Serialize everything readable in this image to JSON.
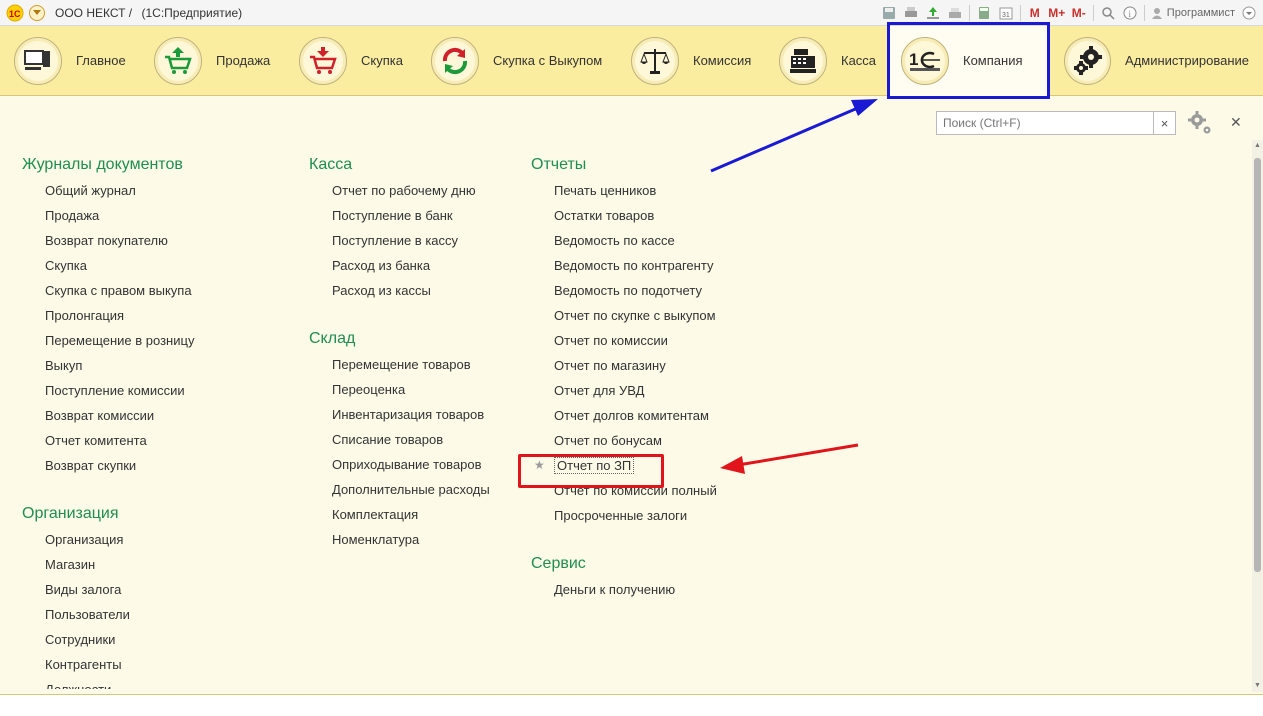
{
  "window": {
    "title_company": "ООО НЕКСТ /",
    "title_app": "(1С:Предприятие)",
    "user": "Программист",
    "mem_labels": [
      "M",
      "M+",
      "M-"
    ]
  },
  "sections": [
    {
      "label": "Главное",
      "icon": "computer-icon"
    },
    {
      "label": "Продажа",
      "icon": "cart-up-icon"
    },
    {
      "label": "Скупка",
      "icon": "cart-down-icon"
    },
    {
      "label": "Скупка с Выкупом",
      "icon": "cycle-icon"
    },
    {
      "label": "Комиссия",
      "icon": "scales-icon"
    },
    {
      "label": "Касса",
      "icon": "cash-register-icon"
    },
    {
      "label": "Компания",
      "icon": "company-logo-icon"
    },
    {
      "label": "Администрирование",
      "icon": "gears-icon"
    }
  ],
  "search": {
    "placeholder": "Поиск (Ctrl+F)"
  },
  "groups": {
    "journals": {
      "title": "Журналы документов",
      "items": [
        "Общий журнал",
        "Продажа",
        "Возврат покупателю",
        "Скупка",
        "Скупка с правом выкупа",
        "Пролонгация",
        "Перемещение в розницу",
        "Выкуп",
        "Поступление комиссии",
        "Возврат комиссии",
        "Отчет комитента",
        "Возврат скупки"
      ]
    },
    "organization": {
      "title": "Организация",
      "items": [
        "Организация",
        "Магазин",
        "Виды залога",
        "Пользователи",
        "Сотрудники",
        "Контрагенты",
        "Должности"
      ]
    },
    "cash": {
      "title": "Касса",
      "items": [
        "Отчет по рабочему дню",
        "Поступление в банк",
        "Поступление в кассу",
        "Расход из банка",
        "Расход из кассы"
      ]
    },
    "warehouse": {
      "title": "Склад",
      "items": [
        "Перемещение товаров",
        "Переоценка",
        "Инвентаризация товаров",
        "Списание товаров",
        "Оприходывание товаров",
        "Дополнительные расходы",
        "Комплектация",
        "Номенклатура"
      ]
    },
    "reports": {
      "title": "Отчеты",
      "items": [
        "Печать ценников",
        "Остатки товаров",
        "Ведомость по кассе",
        "Ведомость по контрагенту",
        "Ведомость по подотчету",
        "Отчет по скупке с выкупом",
        "Отчет по комиссии",
        "Отчет по магазину",
        "Отчет для УВД",
        "Отчет долгов комитентам",
        "Отчет по бонусам",
        "Отчет по ЗП",
        "Отчет по комиссии полный",
        "Просроченные залоги"
      ]
    },
    "service": {
      "title": "Сервис",
      "items": [
        "Деньги к получению"
      ]
    }
  },
  "colors": {
    "section_bar": "#fbeda0",
    "content_bg": "#fdfbe8",
    "group_title": "#1f8e4f",
    "highlight_blue": "#1a1ad4",
    "highlight_red": "#e0141a"
  }
}
